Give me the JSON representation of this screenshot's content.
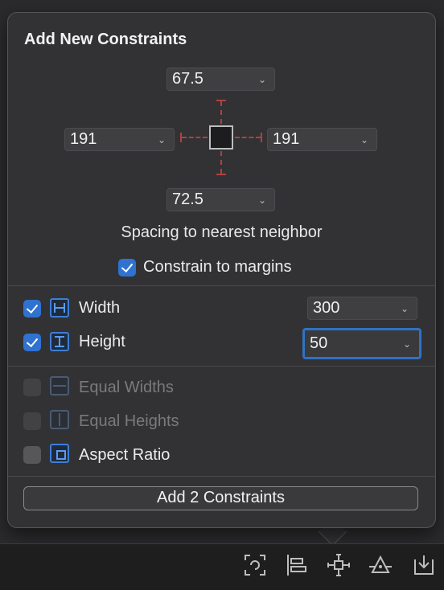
{
  "popover": {
    "title": "Add New Constraints",
    "spacing": {
      "top": "67.5",
      "left": "191",
      "right": "191",
      "bottom": "72.5"
    },
    "caption": "Spacing to nearest neighbor",
    "constrain_margins": {
      "label": "Constrain to margins",
      "checked": true
    },
    "width": {
      "label": "Width",
      "value": "300",
      "checked": true
    },
    "height": {
      "label": "Height",
      "value": "50",
      "checked": true
    },
    "equal_widths": {
      "label": "Equal Widths",
      "checked": false,
      "enabled": false
    },
    "equal_heights": {
      "label": "Equal Heights",
      "checked": false,
      "enabled": false
    },
    "aspect_ratio": {
      "label": "Aspect Ratio",
      "checked": false,
      "enabled": true
    },
    "add_button": "Add 2 Constraints"
  },
  "toolbar": {
    "icons": [
      "update-frames-icon",
      "align-icon",
      "add-constraints-icon",
      "resolve-issues-icon",
      "embed-in-icon"
    ]
  }
}
